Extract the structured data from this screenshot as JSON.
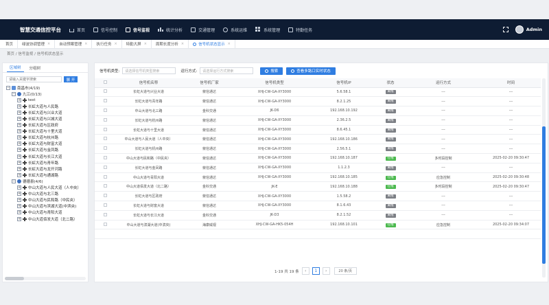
{
  "app": {
    "title": "智慧交通信控平台",
    "user": "Admin"
  },
  "nav": [
    {
      "label": "首页",
      "icon": "home-icon"
    },
    {
      "label": "信号控制",
      "icon": "signal-icon"
    },
    {
      "label": "信号监视",
      "icon": "monitor-icon",
      "active": true
    },
    {
      "label": "统计分析",
      "icon": "chart-icon"
    },
    {
      "label": "交通管理",
      "icon": "traffic-icon"
    },
    {
      "label": "系统运维",
      "icon": "tools-icon"
    },
    {
      "label": "系统管理",
      "icon": "grid-icon"
    },
    {
      "label": "特勤任务",
      "icon": "task-icon"
    }
  ],
  "tabs": [
    {
      "label": "首页"
    },
    {
      "label": "绿波协调管理"
    },
    {
      "label": "自动预案管理"
    },
    {
      "label": "执行任务"
    },
    {
      "label": "特勤大屏"
    },
    {
      "label": "周期长度分析"
    },
    {
      "label": "信号机状态显示",
      "active": true
    }
  ],
  "breadcrumb": "首页 / 信号监视 / 信号机状态显示",
  "left": {
    "tabs": [
      "区域树",
      "分组树"
    ],
    "search_placeholder": "请输入关键字搜索",
    "expand_label": "展 开",
    "tree": [
      {
        "level": 0,
        "toggle": "−",
        "icon": "org",
        "label": "南昌市(4/19)"
      },
      {
        "level": 1,
        "toggle": "−",
        "icon": "node",
        "label": "九江(0/13)"
      },
      {
        "level": 2,
        "toggle": "+",
        "icon": "cross",
        "label": "test"
      },
      {
        "level": 2,
        "toggle": "+",
        "icon": "cross",
        "label": "长虹大道与人民路"
      },
      {
        "level": 2,
        "toggle": "+",
        "icon": "cross",
        "label": "长虹大道与兴业大道"
      },
      {
        "level": 2,
        "toggle": "+",
        "icon": "cross",
        "label": "长虹大道与兴城大道"
      },
      {
        "level": 2,
        "toggle": "+",
        "icon": "cross",
        "label": "长虹大道与区政府"
      },
      {
        "level": 2,
        "toggle": "+",
        "icon": "cross",
        "label": "长虹大道与十里大道"
      },
      {
        "level": 2,
        "toggle": "+",
        "icon": "cross",
        "label": "长虹大道与杭州路"
      },
      {
        "level": 2,
        "toggle": "+",
        "icon": "cross",
        "label": "长虹大道与财富大道"
      },
      {
        "level": 2,
        "toggle": "+",
        "icon": "cross",
        "label": "长虹大道与金凤路"
      },
      {
        "level": 2,
        "toggle": "+",
        "icon": "cross",
        "label": "长虹大道与长江大道"
      },
      {
        "level": 2,
        "toggle": "+",
        "icon": "cross",
        "label": "长虹大道与青年路"
      },
      {
        "level": 2,
        "toggle": "+",
        "icon": "cross",
        "label": "长虹大道与龙开河路"
      },
      {
        "level": 2,
        "toggle": "+",
        "icon": "cross",
        "label": "长虹大道与通湖路"
      },
      {
        "level": 1,
        "toggle": "−",
        "icon": "node",
        "label": "德德县(4/6)"
      },
      {
        "level": 2,
        "toggle": "+",
        "icon": "cross",
        "label": "中山大道与人民大道（人中央）"
      },
      {
        "level": 2,
        "toggle": "+",
        "icon": "cross",
        "label": "中山大道与北三路"
      },
      {
        "level": 2,
        "toggle": "+",
        "icon": "cross",
        "label": "中山大道与民和路（中民央）"
      },
      {
        "level": 2,
        "toggle": "+",
        "icon": "cross",
        "label": "中山大道与滨湖大道(中滨央)"
      },
      {
        "level": 2,
        "toggle": "+",
        "icon": "cross",
        "label": "中山大道与青阳大道"
      },
      {
        "level": 2,
        "toggle": "+",
        "icon": "cross",
        "label": "中山大道佰发大道（北二路）"
      }
    ]
  },
  "filters": {
    "type_label": "信号机类型:",
    "type_placeholder": "请选择信号机类型搜索",
    "mode_label": "运行方式:",
    "mode_placeholder": "请选择运行方式搜索",
    "search_button": "搜索",
    "multi_button": "查看多路口实时状态"
  },
  "table": {
    "columns": [
      "",
      "信号机名称",
      "信号机厂家",
      "信号机类型",
      "信号机IP",
      "状态",
      "运行方式",
      "时间"
    ],
    "rows": [
      [
        "长虹大道与兴业大道",
        "荥信通达",
        "XHJ-CW-GA-XY3000",
        "5.6.58.1",
        "离线",
        "---",
        "---"
      ],
      [
        "长虹大道与青年路",
        "荥信通达",
        "XHJ-CW-GA-XY3000",
        "8.2.1.25",
        "离线",
        "---",
        "---"
      ],
      [
        "中山大道与北三路",
        "金科交通",
        "JK-D6",
        "192.168.10.192",
        "离线",
        "---",
        "---"
      ],
      [
        "长虹大道与杭州路",
        "荥信通达",
        "XHJ-CW-GA-XY3000",
        "2.36.2.5",
        "离线",
        "---",
        "---"
      ],
      [
        "长虹大道与十里大道",
        "荥信通达",
        "XHJ-CW-GA-XY3000",
        "8.6.45.1",
        "离线",
        "---",
        "---"
      ],
      [
        "中山大道与人民大道（人中央）",
        "荥信通达",
        "XHJ-CW-GA-XY3000",
        "192.168.10.186",
        "离线",
        "---",
        "---"
      ],
      [
        "长虹大道与机州路",
        "荥信通达",
        "XHJ-CW-GA-XY3000",
        "2.56.5.1",
        "离线",
        "---",
        "---"
      ],
      [
        "中山大道与民和路（中民央）",
        "荥信通达",
        "XHJ-CW-GA-XY3000",
        "192.168.10.187",
        "在线",
        "多时段控制",
        "2025-02-20 09:30:47"
      ],
      [
        "长虹大道与金凤路",
        "荥信通达",
        "XHJ-CW-GA-XY3000",
        "1.1.2.3",
        "离线",
        "---",
        "---"
      ],
      [
        "中山大道与青阳大道",
        "荥信通达",
        "XHJ-CW-GA-XY3000",
        "192.168.10.185",
        "在线",
        "应急控制",
        "2025-02-20 09:30:48"
      ],
      [
        "中山大道佰发大道（北二路）",
        "金科交通",
        "JK-E",
        "192.168.10.188",
        "在线",
        "多时段控制",
        "2025-02-20 09:30:47"
      ],
      [
        "长虹大道与区政府",
        "荥信通达",
        "XHJ-CW-GA-XY3000",
        "1.5.58.2",
        "离线",
        "---",
        "---"
      ],
      [
        "长虹大道与财富大道",
        "荥信通达",
        "XHJ-CW-GA-XY3000",
        "8.1.6.43",
        "离线",
        "---",
        "---"
      ],
      [
        "长虹大道与长江大道",
        "金科交通",
        "JK-D3",
        "8.2.1.52",
        "离线",
        "---",
        "---"
      ],
      [
        "中山大道与滨湖大道(中滨央)",
        "海康威视",
        "XHJ-CW-GA-HK5-054H",
        "192.168.10.101",
        "在线",
        "应急控制",
        "2025-02-20 09:34:07"
      ],
      [
        "",
        "",
        "",
        "",
        "",
        "",
        ""
      ]
    ]
  },
  "pager": {
    "total": "1-19 共 19 条",
    "current": "1",
    "size": "20 条/页"
  },
  "colors": {
    "header": "#0e1c33",
    "accent": "#2f7de1",
    "online": "#4cb94f",
    "offline": "#7c7f85"
  }
}
